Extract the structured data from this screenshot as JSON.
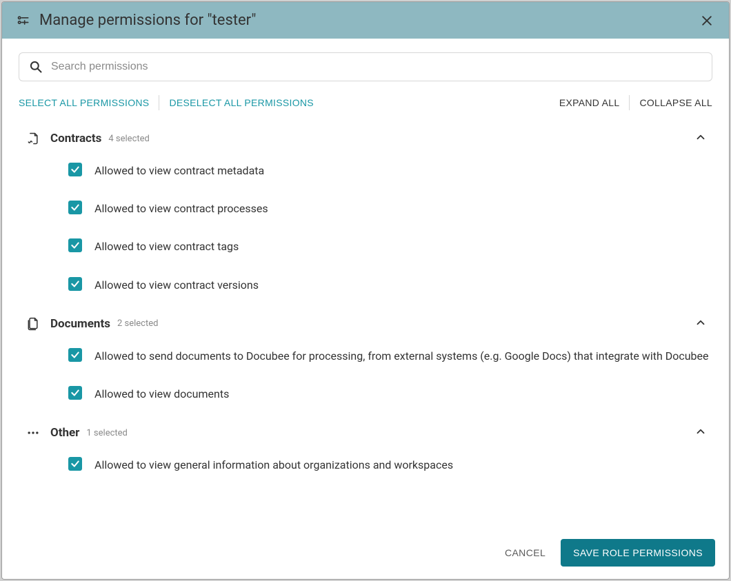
{
  "header": {
    "title": "Manage permissions for \"tester\""
  },
  "search": {
    "placeholder": "Search permissions"
  },
  "toolbar": {
    "select_all": "SELECT ALL PERMISSIONS",
    "deselect_all": "DESELECT ALL PERMISSIONS",
    "expand_all": "EXPAND ALL",
    "collapse_all": "COLLAPSE ALL"
  },
  "groups": [
    {
      "title": "Contracts",
      "count_text": "4 selected",
      "permissions": [
        {
          "label": "Allowed to view contract metadata",
          "checked": true
        },
        {
          "label": "Allowed to view contract processes",
          "checked": true
        },
        {
          "label": "Allowed to view contract tags",
          "checked": true
        },
        {
          "label": "Allowed to view contract versions",
          "checked": true
        }
      ]
    },
    {
      "title": "Documents",
      "count_text": "2 selected",
      "permissions": [
        {
          "label": "Allowed to send documents to Docubee for processing, from external systems (e.g. Google Docs) that integrate with Docubee",
          "checked": true
        },
        {
          "label": "Allowed to view documents",
          "checked": true
        }
      ]
    },
    {
      "title": "Other",
      "count_text": "1 selected",
      "permissions": [
        {
          "label": "Allowed to view general information about organizations and workspaces",
          "checked": true
        }
      ]
    }
  ],
  "footer": {
    "cancel": "CANCEL",
    "save": "SAVE ROLE PERMISSIONS"
  }
}
